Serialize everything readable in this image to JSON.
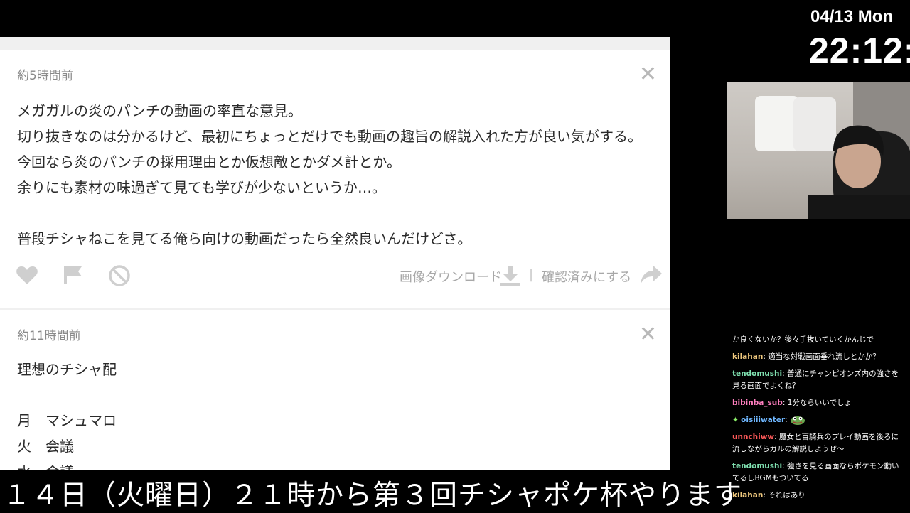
{
  "clock": {
    "date": "04/13 Mon",
    "time": "22:12:"
  },
  "questions": [
    {
      "time_ago": "約5時間前",
      "body": "メガガルの炎のパンチの動画の率直な意見。\n切り抜きなのは分かるけど、最初にちょっとだけでも動画の趣旨の解説入れた方が良い気がする。\n今回なら炎のパンチの採用理由とか仮想敵とかダメ計とか。\n余りにも素材の味過ぎて見ても学びが少ないというか…。\n\n普段チシャねこを見てる俺ら向けの動画だったら全然良いんだけどさ。",
      "download_label": "画像ダウンロード",
      "separator": "|",
      "confirm_label": "確認済みにする"
    },
    {
      "time_ago": "約11時間前",
      "body": "理想のチシャ配\n\n月　マシュマロ\n火　会議\n水　会議"
    }
  ],
  "icons": {
    "close": "close-icon",
    "like": "heart-icon",
    "report": "flag-icon",
    "block": "block-icon",
    "download": "download-icon",
    "confirm": "share-arrow-icon"
  },
  "chat": [
    {
      "user": "",
      "message": "か良くないか？後々手抜いていくかんじで",
      "color": "#ffffff"
    },
    {
      "user": "kilahan",
      "message": "適当な対戦画面垂れ流しとかか？",
      "color": "#f0c97e"
    },
    {
      "user": "tendomushi",
      "message": "普通にチャンピオンズ内の強さを見る画面でよくね？",
      "color": "#7fe0b0"
    },
    {
      "user": "bibinba_sub",
      "message": "1分ならいいでしょ",
      "color": "#ff7fbf"
    },
    {
      "user": "oisiiiwater",
      "message": "",
      "color": "#6fb7ff",
      "badge": "sparkle-icon",
      "emote": "frog-emote-icon"
    },
    {
      "user": "unnchiww",
      "message": "魔女と百騎兵のプレイ動画を後ろに流しながらガルの解説しようぜ～",
      "color": "#ff5a5a"
    },
    {
      "user": "tendomushi",
      "message": "強さを見る画面ならポケモン動いてるしBGMもついてる",
      "color": "#7fe0b0"
    },
    {
      "user": "kilahan",
      "message": "それはあり",
      "color": "#f0c97e"
    }
  ],
  "ticker": {
    "text": "１４日（火曜日）２１時から第３回チシャポケ杯やります"
  },
  "colors": {
    "panel_bg": "#f0f0f0",
    "card_bg": "#ffffff",
    "muted": "#a8a8a8"
  }
}
